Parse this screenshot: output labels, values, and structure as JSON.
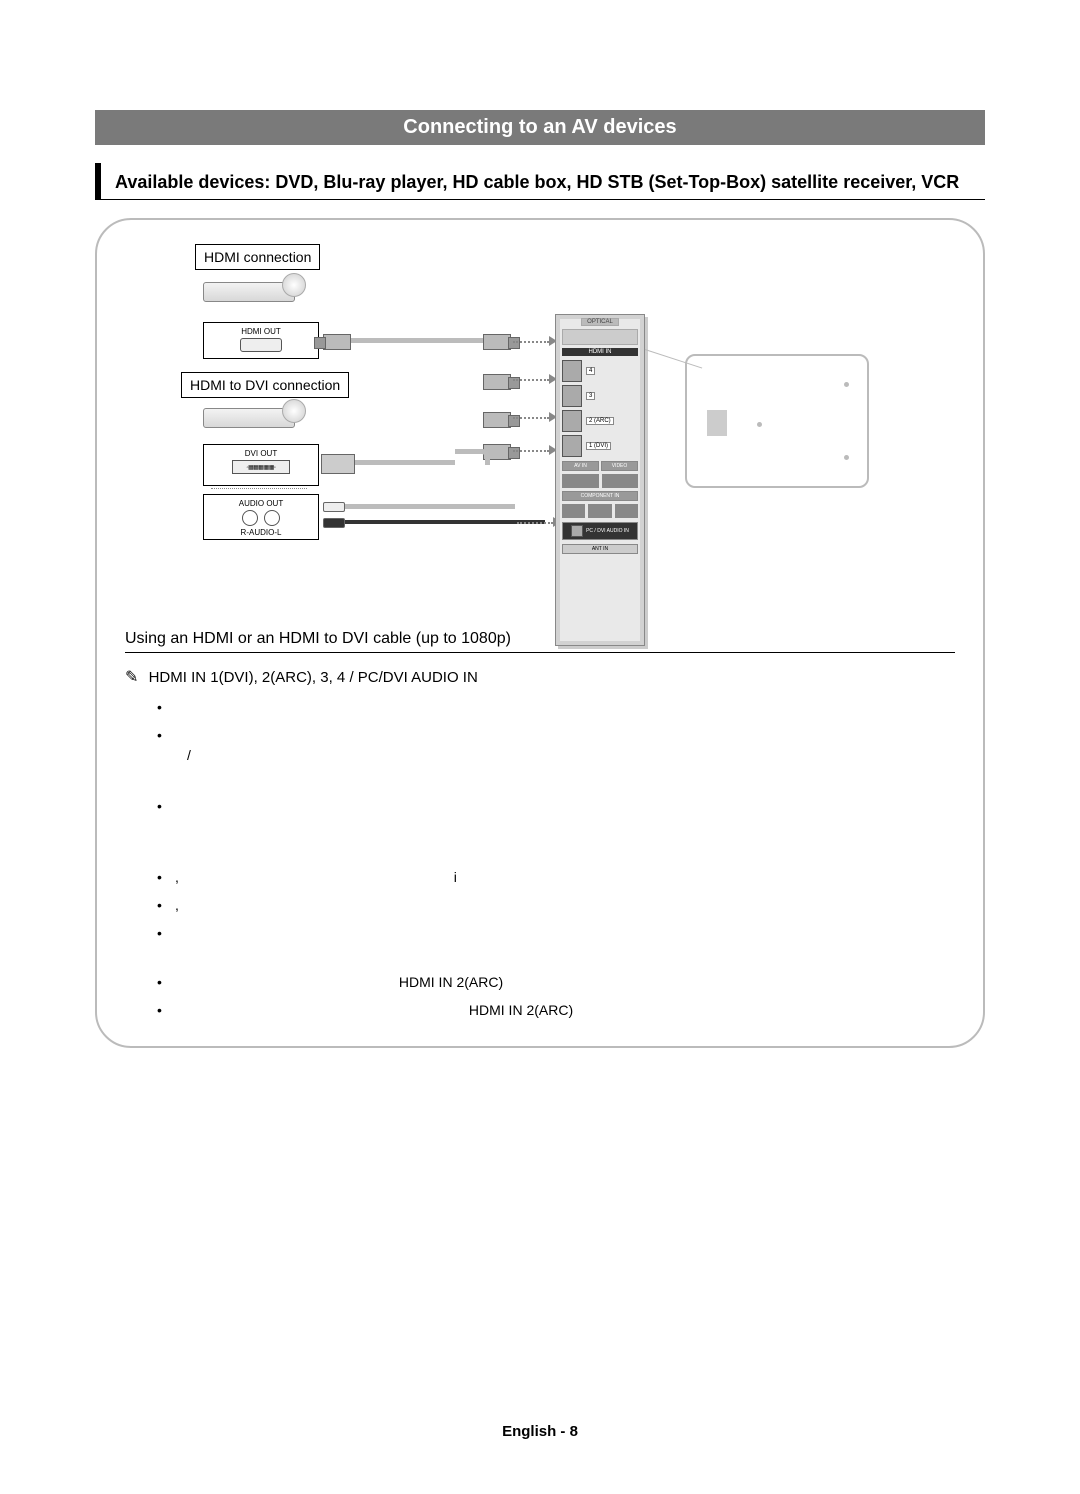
{
  "title": "Connecting to an AV devices",
  "subtitle": "Available devices: DVD, Blu-ray player, HD cable box, HD STB (Set-Top-Box) satellite receiver, VCR",
  "diagram": {
    "hdmi_connection_label": "HDMI connection",
    "hdmi_to_dvi_connection_label": "HDMI to DVI connection",
    "hdmi_out_label": "HDMI OUT",
    "dvi_out_label": "DVI OUT",
    "audio_out_label": "AUDIO OUT",
    "r_audio_l_label": "R-AUDIO-L",
    "tv_panel": {
      "top_label": "OPTICAL",
      "hdmi_in_label": "HDMI IN",
      "ports": [
        "4",
        "3",
        "2 (ARC)",
        "1 (DVI)"
      ],
      "av_in_label": "AV IN",
      "video_label": "VIDEO",
      "component_label": "COMPONENT IN",
      "audio_in_label": "PC / DVI AUDIO IN",
      "antenna_label": "ANT IN"
    }
  },
  "section_header": "Using an HDMI or an HDMI to DVI cable (up to 1080p)",
  "note_prefix_icon": "✎",
  "note_prefix": "HDMI IN 1(DVI), 2(ARC), 3, 4 / PC/DVI AUDIO IN",
  "bullet_visible_fragments": {
    "b4_i": "i",
    "b5_comma": ",",
    "b7_text": "HDMI IN 2(ARC)",
    "b8_text": "HDMI IN 2(ARC)"
  },
  "footer": "English - 8"
}
